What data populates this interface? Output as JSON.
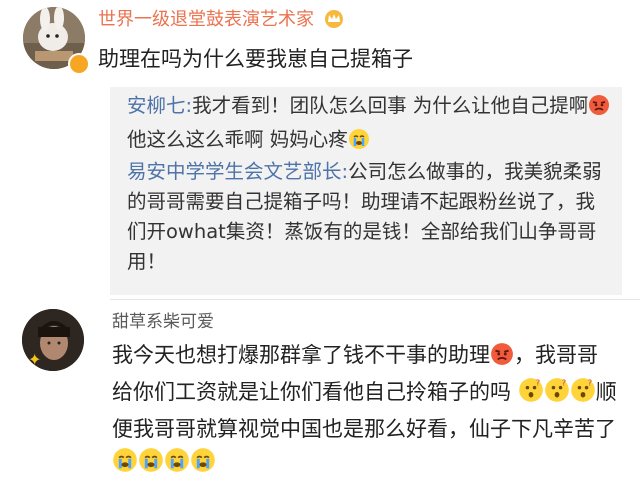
{
  "comments": [
    {
      "username": "世界一级退堂鼓表演艺术家",
      "text": "助理在吗为什么要我崽自己提箱子",
      "replies": [
        {
          "author": "安柳七:",
          "segments": [
            "我才看到！团队怎么回事 为什么让他自己提啊",
            "他这么这么乖啊 妈妈心疼"
          ]
        },
        {
          "author": "易安中学学生会文艺部长:",
          "text": "公司怎么做事的，我美貌柔弱的哥哥需要自己提箱子吗！助理请不起跟粉丝说了，我们开owhat集资！蒸饭有的是钱！全部给我们山争哥哥用！"
        }
      ]
    },
    {
      "username": "甜草系柴可爱",
      "segments": [
        "我今天也想打爆那群拿了钱不干事的助理",
        "，我哥哥给你们工资就是让你们看他自己拎箱子的吗",
        "顺便我哥哥就算视觉中国也是那么好看，仙子下凡辛苦了"
      ]
    }
  ],
  "icons": {
    "crown": "crown-icon",
    "angry": "angry-face-emoji",
    "crying": "crying-face-emoji",
    "confused": "confused-face-emoji",
    "vip": "vip-badge-icon"
  },
  "colors": {
    "username_vip": "#eb7350",
    "username_normal": "#5a5a5a",
    "reply_author": "#4e73a8",
    "reply_bg": "#f2f2f2"
  }
}
